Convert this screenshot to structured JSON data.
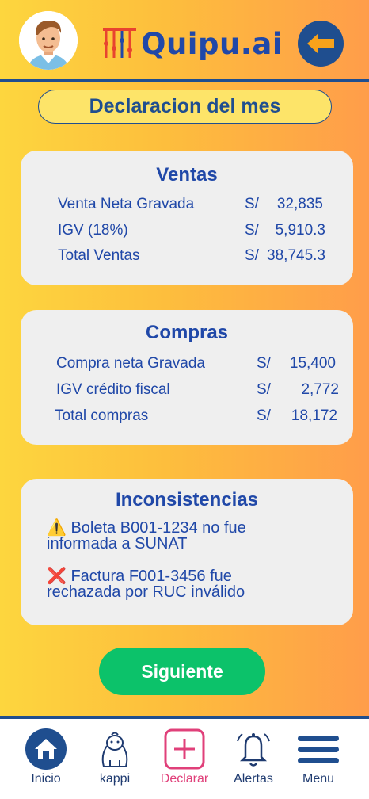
{
  "app": {
    "logo_text": "Quipu.ai",
    "brand_color": "#1f4e8f",
    "accent_color": "#e0407a",
    "page_title": "Declaracion del mes"
  },
  "ventas": {
    "title": "Ventas",
    "rows": [
      {
        "label": "Venta Neta Gravada",
        "currency": "S/",
        "amount": "32,835"
      },
      {
        "label": "IGV (18%)",
        "currency": "S/",
        "amount": "5,910.3"
      },
      {
        "label": "Total Ventas",
        "currency": "S/",
        "amount": "38,745.3"
      }
    ]
  },
  "compras": {
    "title": "Compras",
    "rows": [
      {
        "label": "Compra neta Gravada",
        "currency": "S/",
        "amount": "15,400"
      },
      {
        "label": "IGV crédito fiscal",
        "currency": "S/",
        "amount": "2,772"
      },
      {
        "label": "Total compras",
        "currency": "S/",
        "amount": "18,172"
      }
    ]
  },
  "inconsistencias": {
    "title": "Inconsistencias",
    "items": [
      {
        "icon": "warning-icon",
        "line1": "⚠️ Boleta B001-1234 no fue",
        "line2": "informada a SUNAT"
      },
      {
        "icon": "red-x-icon",
        "line1": "❌ Factura F001-3456 fue",
        "line2": "rechazada por RUC inválido"
      }
    ]
  },
  "next_button": "Siguiente",
  "nav": {
    "items": [
      {
        "label": "Inicio",
        "icon": "home-icon"
      },
      {
        "label": "kappi",
        "icon": "capybara-icon"
      },
      {
        "label": "Declarar",
        "icon": "plus-square-icon",
        "active": true
      },
      {
        "label": "Alertas",
        "icon": "bell-icon"
      },
      {
        "label": "Menu",
        "icon": "hamburger-icon"
      }
    ]
  }
}
